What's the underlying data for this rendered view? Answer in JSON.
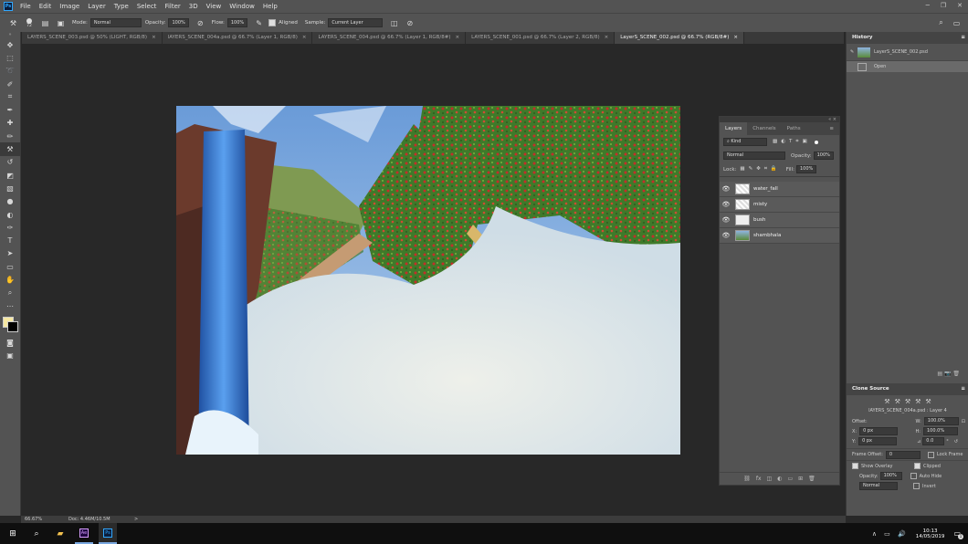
{
  "menubar": {
    "items": [
      "File",
      "Edit",
      "Image",
      "Layer",
      "Type",
      "Select",
      "Filter",
      "3D",
      "View",
      "Window",
      "Help"
    ]
  },
  "options": {
    "brush_size": "72",
    "mode_label": "Mode:",
    "mode_value": "Normal",
    "opacity_label": "Opacity:",
    "opacity_value": "100%",
    "flow_label": "Flow:",
    "flow_value": "100%",
    "aligned_label": "Aligned",
    "sample_label": "Sample:",
    "sample_value": "Current Layer"
  },
  "tabs": [
    {
      "label": "LAYERS_SCENE_003.psd @ 50% (LIGHT, RGB/8)",
      "close": "×"
    },
    {
      "label": "lAYERS_SCENE_004a.psd @ 66.7% (Layer 1, RGB/8)",
      "close": "×"
    },
    {
      "label": "LAYERS_SCENE_004.psd @ 66.7% (Layer 1, RGB/8#)",
      "close": "×"
    },
    {
      "label": "LAYERS_SCENE_001.psd @ 66.7% (Layer 2, RGB/8)",
      "close": "×"
    },
    {
      "label": "LayerS_SCENE_002.psd @ 66.7% (RGB/8#)",
      "close": "×"
    }
  ],
  "layers_panel": {
    "tabs": [
      "Layers",
      "Channels",
      "Paths"
    ],
    "kind_label": "Kind",
    "blend_mode": "Normal",
    "opacity_label": "Opacity:",
    "opacity_value": "100%",
    "lock_label": "Lock:",
    "fill_label": "Fill:",
    "fill_value": "100%",
    "layers": [
      {
        "name": "water_fall"
      },
      {
        "name": "misty"
      },
      {
        "name": "bush"
      },
      {
        "name": "shambhala"
      }
    ]
  },
  "history": {
    "title": "History",
    "snapshot": "LayerS_SCENE_002.psd",
    "state": "Open"
  },
  "clone_source": {
    "title": "Clone Source",
    "source_file": "lAYERS_SCENE_004a.psd : Layer 4",
    "offset_label": "Offset:",
    "x_label": "X:",
    "x_value": "0 px",
    "y_label": "Y:",
    "y_value": "0 px",
    "w_label": "W:",
    "w_value": "100.0%",
    "h_label": "H:",
    "h_value": "100.0%",
    "angle_value": "0.0",
    "angle_unit": "°",
    "frame_offset_label": "Frame Offset:",
    "frame_offset_value": "0",
    "lock_frame": "Lock Frame",
    "show_overlay": "Show Overlay",
    "clipped": "Clipped",
    "opacity_label": "Opacity:",
    "opacity_value": "100%",
    "auto_hide": "Auto Hide",
    "mode_value": "Normal",
    "invert": "Invert"
  },
  "status": {
    "zoom": "66.67%",
    "doc": "Doc: 4.46M/10.5M",
    "arrow": ">"
  },
  "taskbar": {
    "time": "10:13",
    "date": "14/05/2019",
    "notification_count": "1",
    "app_ae": "Ae",
    "app_ps": "Ps"
  }
}
